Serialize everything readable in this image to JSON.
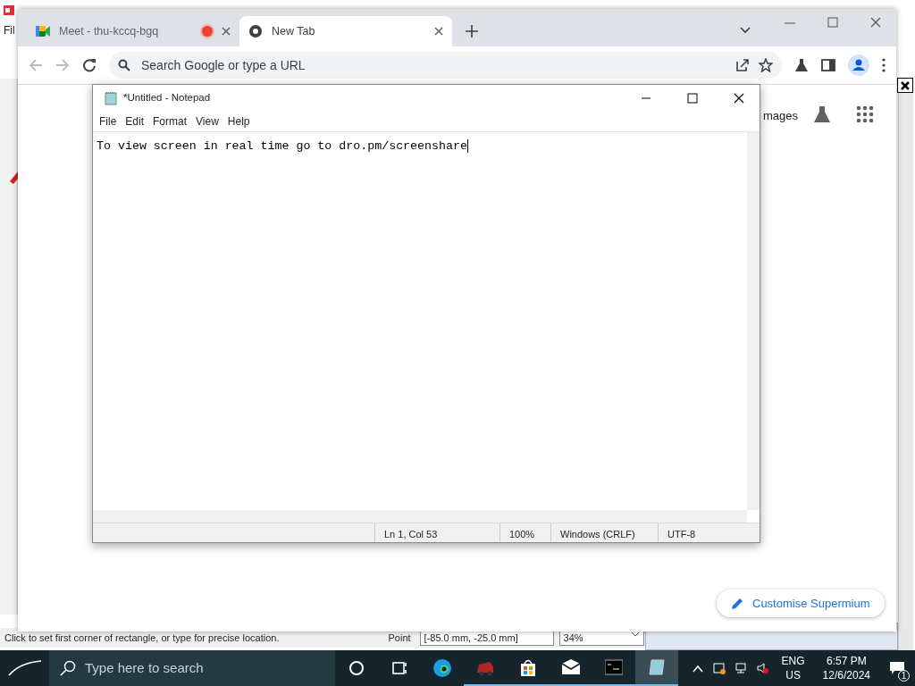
{
  "background_app": {
    "menu": [
      "Fil"
    ],
    "status_text": "Click to set first corner of rectangle, or type for precise location.",
    "coord_label": "Point",
    "coord_value": "[-85.0 mm, -25.0 mm]",
    "zoom": "34%"
  },
  "browser": {
    "tabs": [
      {
        "label": "Meet - thu-kccq-bgq",
        "selected": false,
        "recording": true
      },
      {
        "label": "New Tab",
        "selected": true,
        "recording": false
      }
    ],
    "address": {
      "placeholder": "Search Google or type a URL"
    },
    "page": {
      "link": "mages",
      "customise_button": "Customise Supermium"
    }
  },
  "notepad": {
    "title": "*Untitled - Notepad",
    "menu": [
      "File",
      "Edit",
      "Format",
      "View",
      "Help"
    ],
    "text": "To view screen in real time go to dro.pm/screenshare",
    "status": [
      "Ln 1, Col 53",
      "100%",
      "Windows (CRLF)",
      "UTF-8"
    ]
  },
  "taskbar": {
    "search_placeholder": "Type here to search",
    "language": "ENG",
    "region": "US",
    "time": "6:57 PM",
    "date": "12/6/2024",
    "notifications": "1"
  }
}
